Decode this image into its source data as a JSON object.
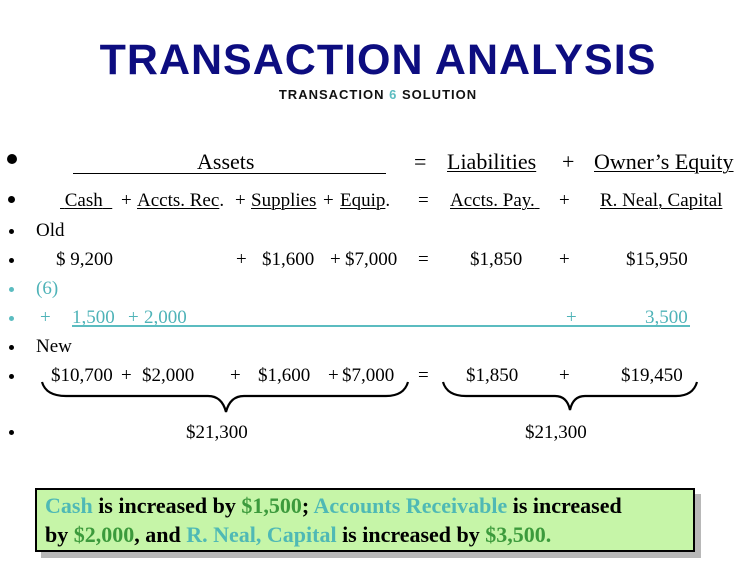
{
  "title": "TRANSACTION ANALYSIS",
  "subtitle": {
    "prefix": "TRANSACTION",
    "number": "6",
    "suffix": "SOLUTION"
  },
  "header": {
    "assets": "Assets",
    "equals": "=",
    "liabilities": "Liabilities",
    "plus": "+",
    "owners_equity": "Owner’s Equity"
  },
  "accounts": {
    "cash": "Cash",
    "plus1": "+",
    "accts_rec": "Accts. Rec",
    "dot1": ".",
    "plus2": "+",
    "supplies": "Supplies",
    "plus3": "+",
    "equip": "Equip",
    "dot2": ".",
    "equals": "=",
    "accts_pay": "Accts. Pay.",
    "plus4": "+",
    "capital": "R. Neal, Capital"
  },
  "old": {
    "label": "Old",
    "cash": "$ 9,200",
    "plus_supplies": "+",
    "supplies": "$1,600",
    "plus_equip": "+",
    "equip": "$7,000",
    "equals": "=",
    "accts_pay": "$1,850",
    "plus_capital": "+",
    "capital": "$15,950"
  },
  "transaction": {
    "label": "(6)",
    "plus_cash": "+",
    "cash": "1,500",
    "plus_rec": "+",
    "accts_rec": "2,000",
    "plus_capital": "+",
    "capital": "3,500"
  },
  "new": {
    "label": "New",
    "cash": "$10,700",
    "plus_rec": "+",
    "accts_rec": "$2,000",
    "plus_supplies": "+",
    "supplies": "$1,600",
    "plus_equip": "+",
    "equip": "$7,000",
    "equals": "=",
    "accts_pay": "$1,850",
    "plus_capital": "+",
    "capital": "$19,450"
  },
  "totals": {
    "assets_total": "$21,300",
    "liabilities_equity_total": "$21,300"
  },
  "summary": {
    "parts": [
      {
        "text": "Cash",
        "style": "teal"
      },
      {
        "text": " is increased by ",
        "style": "plain"
      },
      {
        "text": "$1,500",
        "style": "green"
      },
      {
        "text": "; ",
        "style": "plain"
      },
      {
        "text": "Accounts Receivable",
        "style": "teal"
      },
      {
        "text": " is increased",
        "style": "plain"
      },
      {
        "text": "by ",
        "style": "plain"
      },
      {
        "text": "$2,000",
        "style": "green"
      },
      {
        "text": ", and ",
        "style": "plain"
      },
      {
        "text": "R. Neal, Capital",
        "style": "teal"
      },
      {
        "text": " is increased by ",
        "style": "plain"
      },
      {
        "text": "$3,500.",
        "style": "green"
      }
    ]
  },
  "colors": {
    "title": "#0d0d80",
    "highlight_teal": "#4fb9b5",
    "highlight_green": "#3c9a3c",
    "box_background": "#c6f5a8"
  }
}
